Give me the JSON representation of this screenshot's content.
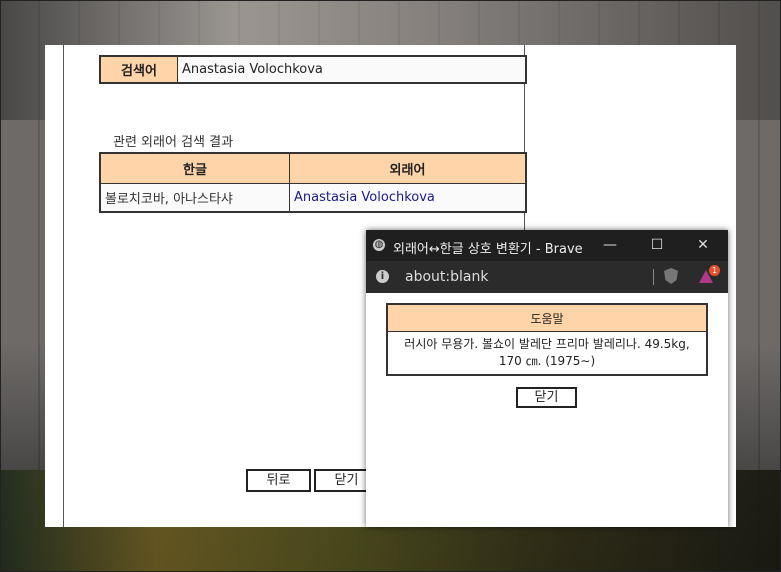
{
  "main": {
    "search": {
      "head": "검색어",
      "value": "Anastasia Volochkova"
    },
    "related_title": "관련 외래어 검색 결과",
    "results": {
      "headers": [
        "한글",
        "외래어"
      ],
      "rows": [
        {
          "korean": "볼로치코바, 아나스타샤",
          "foreign": "Anastasia Volochkova"
        }
      ]
    },
    "buttons": {
      "back": "뒤로",
      "close": "닫기"
    }
  },
  "popup": {
    "title": "외래어↔한글 상호 변환기 - Brave",
    "address": "about:blank",
    "badge_count": "1",
    "help": {
      "header": "도움말",
      "text": "러시아 무용가. 볼쇼이 발레단 프리마 발레리나. 49.5kg, 170 ㎝. (1975∼)"
    },
    "close_label": "닫기"
  },
  "colors": {
    "header_bg": "#ffd4a8",
    "link": "#1a1a8c",
    "titlebar": "#1f1f1f"
  }
}
